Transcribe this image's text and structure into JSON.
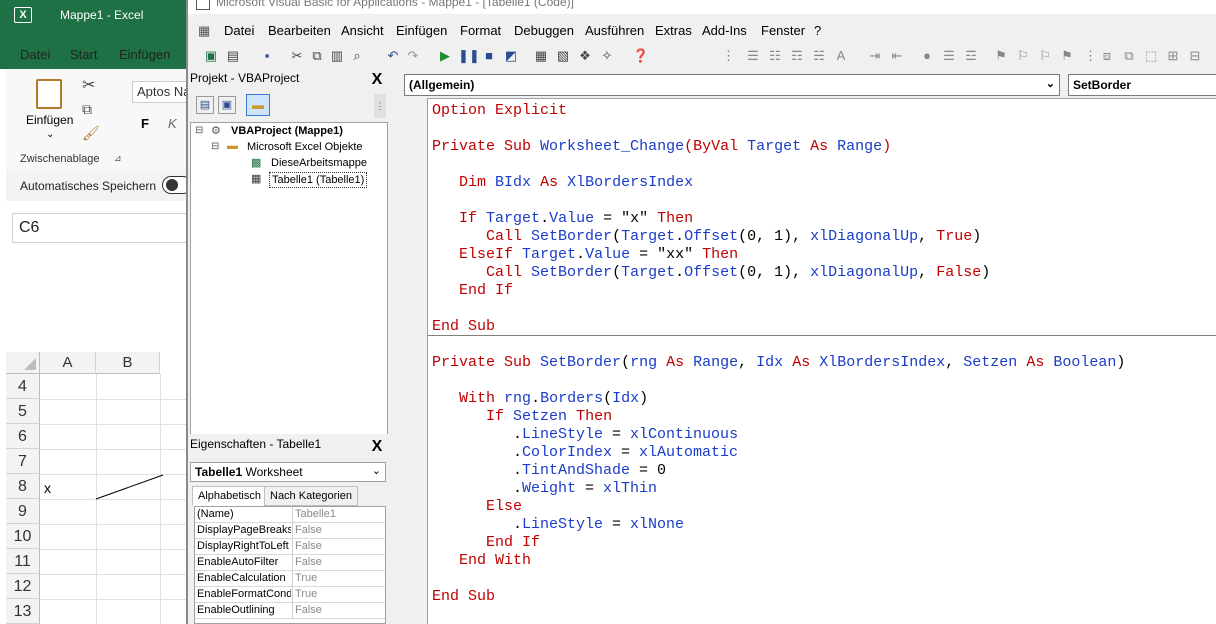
{
  "excel": {
    "title": "Mappe1 - Excel",
    "logo": "X",
    "tabs": [
      "Datei",
      "Start",
      "Einfügen"
    ],
    "ribbon": {
      "paste_label": "Einfügen",
      "font_name": "Aptos Na",
      "group_label": "Zwischenablage",
      "bold": "F",
      "italic": "K"
    },
    "autosave_label": "Automatisches Speichern",
    "namebox": "C6",
    "columns": [
      "A",
      "B"
    ],
    "rows": [
      "4",
      "5",
      "6",
      "7",
      "8",
      "9",
      "10",
      "11",
      "12",
      "13"
    ],
    "cell_a8": "x"
  },
  "vbe": {
    "title": "Microsoft Visual Basic for Applications - Mappe1 - [Tabelle1 (Code)]",
    "menu": [
      "Datei",
      "Bearbeiten",
      "Ansicht",
      "Einfügen",
      "Format",
      "Debuggen",
      "Ausführen",
      "Extras",
      "Add-Ins",
      "Fenster",
      "?"
    ],
    "project": {
      "title": "Projekt - VBAProject",
      "close": "X",
      "root": "VBAProject (Mappe1)",
      "folder": "Microsoft Excel Objekte",
      "items": [
        "DieseArbeitsmappe",
        "Tabelle1 (Tabelle1)"
      ]
    },
    "properties": {
      "title": "Eigenschaften - Tabelle1",
      "close": "X",
      "object_name": "Tabelle1",
      "object_type": "Worksheet",
      "tabs": [
        "Alphabetisch",
        "Nach Kategorien"
      ],
      "rows": [
        {
          "k": "(Name)",
          "v": "Tabelle1"
        },
        {
          "k": "DisplayPageBreaks",
          "v": "False"
        },
        {
          "k": "DisplayRightToLeft",
          "v": "False"
        },
        {
          "k": "EnableAutoFilter",
          "v": "False"
        },
        {
          "k": "EnableCalculation",
          "v": "True"
        },
        {
          "k": "EnableFormatConditionsCalculation",
          "v": "True"
        },
        {
          "k": "EnableOutlining",
          "v": "False"
        }
      ]
    },
    "code": {
      "object_combo": "(Allgemein)",
      "proc_combo": "SetBorder"
    }
  },
  "colors": {
    "excel_green": "#1e7145",
    "keyword": "#c00000",
    "identifier": "#1a3cc8"
  }
}
